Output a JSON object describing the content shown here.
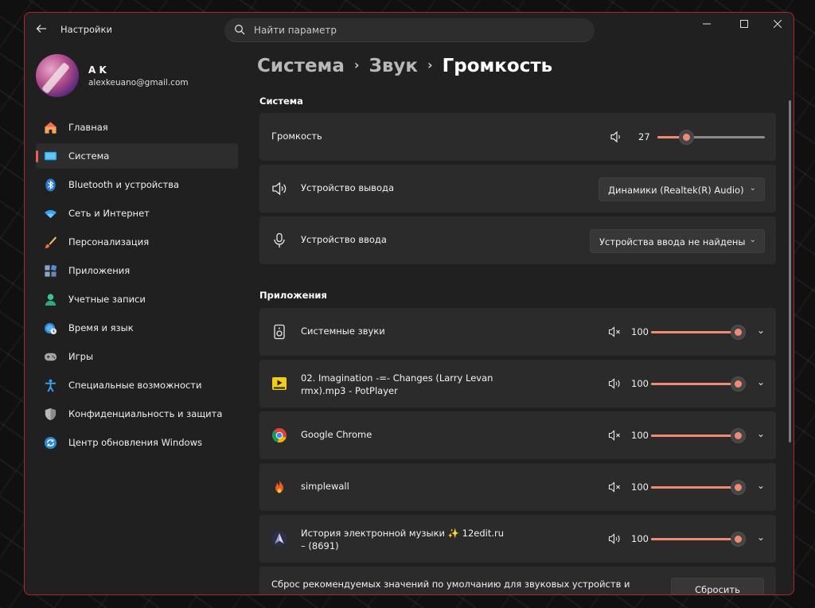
{
  "app": {
    "title": "Настройки"
  },
  "search": {
    "placeholder": "Найти параметр"
  },
  "user": {
    "name": "A K",
    "email": "alexkeuano@gmail.com"
  },
  "nav": {
    "items": [
      {
        "label": "Главная",
        "icon": "home-icon",
        "active": false
      },
      {
        "label": "Система",
        "icon": "system-icon",
        "active": true
      },
      {
        "label": "Bluetooth и устройства",
        "icon": "bluetooth-icon",
        "active": false
      },
      {
        "label": "Сеть и Интернет",
        "icon": "wifi-icon",
        "active": false
      },
      {
        "label": "Персонализация",
        "icon": "brush-icon",
        "active": false
      },
      {
        "label": "Приложения",
        "icon": "apps-icon",
        "active": false
      },
      {
        "label": "Учетные записи",
        "icon": "account-icon",
        "active": false
      },
      {
        "label": "Время и язык",
        "icon": "globe-clock-icon",
        "active": false
      },
      {
        "label": "Игры",
        "icon": "gamepad-icon",
        "active": false
      },
      {
        "label": "Специальные возможности",
        "icon": "accessibility-icon",
        "active": false
      },
      {
        "label": "Конфиденциальность и защита",
        "icon": "shield-icon",
        "active": false
      },
      {
        "label": "Центр обновления Windows",
        "icon": "update-icon",
        "active": false
      }
    ]
  },
  "breadcrumb": {
    "part1": "Система",
    "part2": "Звук",
    "current": "Громкость"
  },
  "system_section": {
    "title": "Система",
    "volume": {
      "label": "Громкость",
      "value": "27",
      "level": 0.27
    },
    "output": {
      "label": "Устройство вывода",
      "selected": "Динамики (Realtek(R) Audio)"
    },
    "input": {
      "label": "Устройство ввода",
      "selected": "Устройства ввода не найдены"
    }
  },
  "apps_section": {
    "title": "Приложения",
    "apps": [
      {
        "name": "Системные звуки",
        "volume": "100",
        "muted": true,
        "icon": "speaker-device-icon"
      },
      {
        "name": "02. Imagination -=- Changes (Larry Levan rmx).mp3 - PotPlayer",
        "volume": "100",
        "muted": false,
        "icon": "potplayer-icon"
      },
      {
        "name": "Google Chrome",
        "volume": "100",
        "muted": true,
        "icon": "chrome-icon"
      },
      {
        "name": "simplewall",
        "volume": "100",
        "muted": true,
        "icon": "flame-icon"
      },
      {
        "name": "История электронной музыки ✨ 12edit.ru – (8691)",
        "volume": "100",
        "muted": false,
        "icon": "app-logo-icon"
      }
    ]
  },
  "reset": {
    "text": "Сброс рекомендуемых значений по умолчанию для звуковых устройств и",
    "button": "Сбросить"
  },
  "colors": {
    "accent": "#f08a73",
    "border": "#b3262a"
  }
}
